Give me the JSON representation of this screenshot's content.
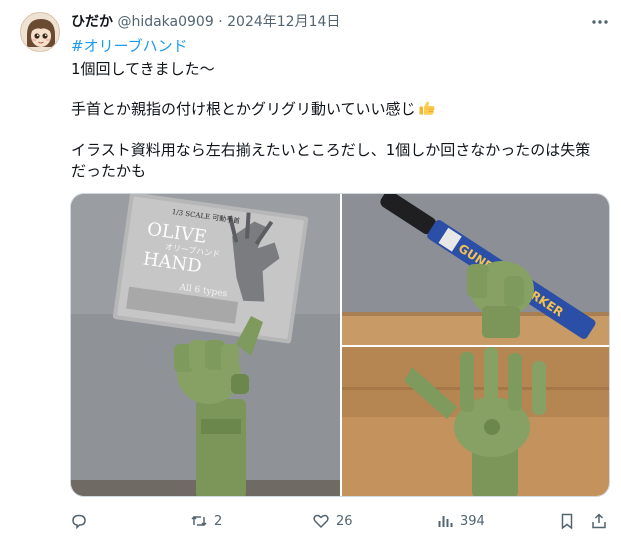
{
  "tweet": {
    "author_name": "ひだか",
    "handle": "@hidaka0909",
    "separator": "·",
    "date": "2024年12月14日",
    "hashtag": "#オリーブハンド",
    "lines": [
      "1個回してきました〜",
      "手首とか親指の付け根とかグリグリ動いていい感じ",
      "イラスト資料用なら左右揃えたいところだし、1個しか回さなかったのは失策",
      "だったかも"
    ],
    "emoji": "thumbs-up-icon"
  },
  "media": {
    "photos": [
      {
        "subject": "olive-hand-figure-holding-card",
        "card": {
          "scale_text": "1/3 SCALE 可動手首",
          "title_line1": "OLIVE",
          "title_line2": "HAND",
          "subtitle": "オリーブハンド",
          "types": "All 6 types"
        }
      },
      {
        "subject": "olive-hand-holding-marker",
        "marker_text": "GUNDAM MARKER"
      },
      {
        "subject": "olive-hand-open-fingers"
      }
    ]
  },
  "actions": {
    "reply_count": "",
    "retweet_count": "2",
    "like_count": "26",
    "views_count": "394"
  },
  "colors": {
    "accent": "#1d9bf0",
    "secondary_text": "#536471",
    "olive_green": "#7e9a5c"
  }
}
